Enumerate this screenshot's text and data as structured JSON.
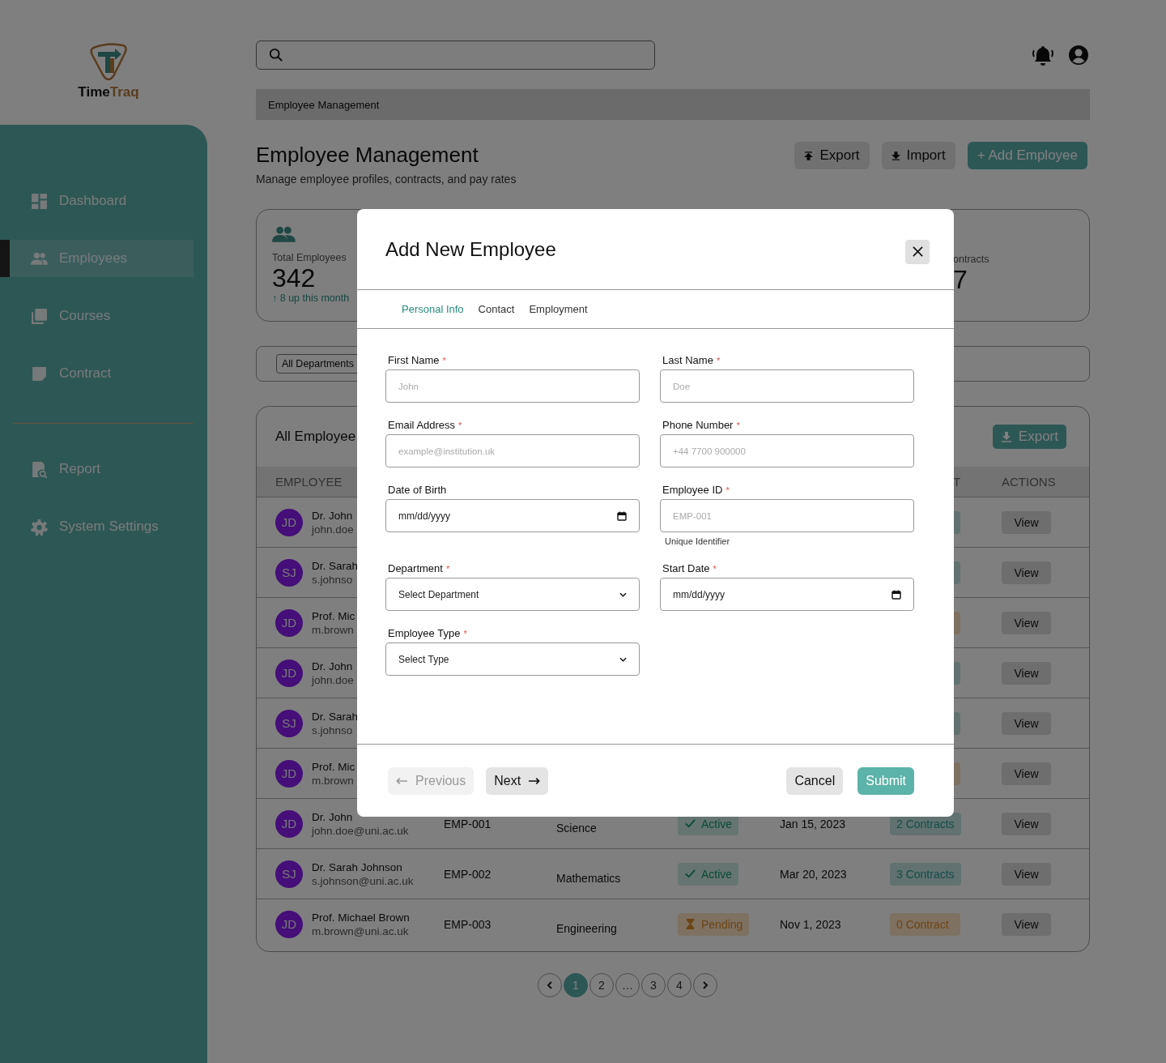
{
  "brand": {
    "wordmark_first": "Time",
    "wordmark_second": "Traq"
  },
  "sidebar": {
    "items": [
      {
        "label": "Dashboard",
        "selected": false
      },
      {
        "label": "Employees",
        "selected": true
      },
      {
        "label": "Courses",
        "selected": false
      },
      {
        "label": "Contract",
        "selected": false
      }
    ],
    "lower_items": [
      {
        "label": "Report",
        "selected": false
      },
      {
        "label": "System Settings",
        "selected": false
      }
    ]
  },
  "breadcrumb": "Employee Management",
  "page_header": {
    "title": "Employee Management",
    "subtitle": "Manage employee profiles, contracts, and pay rates",
    "buttons": [
      {
        "label": "Export",
        "kind": "export"
      },
      {
        "label": "Import",
        "kind": "import"
      },
      {
        "label": "+ Add Employee",
        "kind": "primary"
      }
    ]
  },
  "stats": [
    {
      "label": "Total Employees",
      "value": "342",
      "trend": "↑ 8 up this month"
    },
    {
      "label": "ontracts",
      "value": "7"
    }
  ],
  "filters": {
    "department": "All Departments"
  },
  "employees": {
    "title": "All Employee",
    "export": "Export",
    "columns": [
      "EMPLOYEE",
      "T",
      "ACTIONS"
    ],
    "rows": [
      {
        "initials": "JD",
        "name": "Dr. John",
        "email": "john.doe",
        "contracts": {
          "kind": "teal"
        },
        "action": "View"
      },
      {
        "initials": "SJ",
        "name": "Dr. Sarah",
        "email": "s.johnso",
        "contracts": {
          "kind": "teal"
        },
        "action": "View"
      },
      {
        "initials": "JD",
        "name": "Prof. Mic",
        "email": "m.brown",
        "contracts": {
          "kind": "orange"
        },
        "action": "View"
      },
      {
        "initials": "JD",
        "name": "Dr. John",
        "email": "john.doe",
        "contracts": {
          "kind": "teal"
        },
        "action": "View"
      },
      {
        "initials": "SJ",
        "name": "Dr. Sarah",
        "email": "s.johnso",
        "contracts": {
          "kind": "teal"
        },
        "action": "View"
      },
      {
        "initials": "JD",
        "name": "Prof. Mic",
        "email": "m.brown",
        "contracts": {
          "kind": "orange"
        },
        "action": "View"
      },
      {
        "initials": "JD",
        "name": "Dr. John",
        "email": "john.doe@uni.ac.uk",
        "id": "EMP-001",
        "department": "Science",
        "status": {
          "label": "Active",
          "kind": "active"
        },
        "start_date": "Jan 15, 2023",
        "contracts": {
          "label": "2 Contracts",
          "kind": "teal"
        },
        "action": "View"
      },
      {
        "initials": "SJ",
        "name": "Dr. Sarah Johnson",
        "email": "s.johnson@uni.ac.uk",
        "id": "EMP-002",
        "department": "Mathematics",
        "status": {
          "label": "Active",
          "kind": "active"
        },
        "start_date": "Mar 20, 2023",
        "contracts": {
          "label": "3 Contracts",
          "kind": "teal"
        },
        "action": "View"
      },
      {
        "initials": "JD",
        "name": "Prof. Michael Brown",
        "email": "m.brown@uni.ac.uk",
        "id": "EMP-003",
        "department": "Engineering",
        "status": {
          "label": "Pending",
          "kind": "pending"
        },
        "start_date": "Nov 1, 2023",
        "contracts": {
          "label": "0 Contract",
          "kind": "orange"
        },
        "action": "View"
      }
    ]
  },
  "pagination": {
    "pages": [
      {
        "label": "1",
        "selected": true
      },
      {
        "label": "2",
        "selected": false
      },
      {
        "label": "…",
        "selected": false
      },
      {
        "label": "3",
        "selected": false
      },
      {
        "label": "4",
        "selected": false
      }
    ]
  },
  "modal": {
    "title": "Add New Employee",
    "tabs": [
      {
        "label": "Personal Info",
        "selected": true
      },
      {
        "label": "Contact",
        "selected": false
      },
      {
        "label": "Employment",
        "selected": false
      }
    ],
    "fields": [
      {
        "label": "First Name",
        "required_mark": "*",
        "kind": "text",
        "placeholder": "John"
      },
      {
        "label": "Last Name",
        "required_mark": "*",
        "kind": "text",
        "placeholder": "Doe"
      },
      {
        "label": "Email Address",
        "required_mark": "*",
        "kind": "text",
        "placeholder": "example@institution.uk"
      },
      {
        "label": "Phone Number",
        "required_mark": "*",
        "kind": "text",
        "placeholder": "+44 7700 900000"
      },
      {
        "label": "Date of Birth",
        "kind": "date",
        "placeholder": "mm/dd/yyyy"
      },
      {
        "label": "Employee ID",
        "required_mark": "*",
        "kind": "text",
        "placeholder": "EMP-001",
        "help": "Unique Identifier"
      },
      {
        "label": "Department",
        "required_mark": "*",
        "kind": "select",
        "placeholder": "Select Department"
      },
      {
        "label": "Start Date",
        "required_mark": "*",
        "kind": "date",
        "placeholder": "mm/dd/yyyy"
      },
      {
        "label": "Employee Type",
        "required_mark": "*",
        "kind": "select",
        "placeholder": "Select Type"
      }
    ],
    "buttons": [
      {
        "label": "Previous",
        "kind": "previous",
        "disabled": true
      },
      {
        "label": "Next",
        "kind": "next",
        "disabled": false
      },
      {
        "label": "Cancel",
        "kind": "cancel",
        "disabled": false
      },
      {
        "label": "Submit",
        "kind": "submit",
        "disabled": false
      }
    ]
  }
}
